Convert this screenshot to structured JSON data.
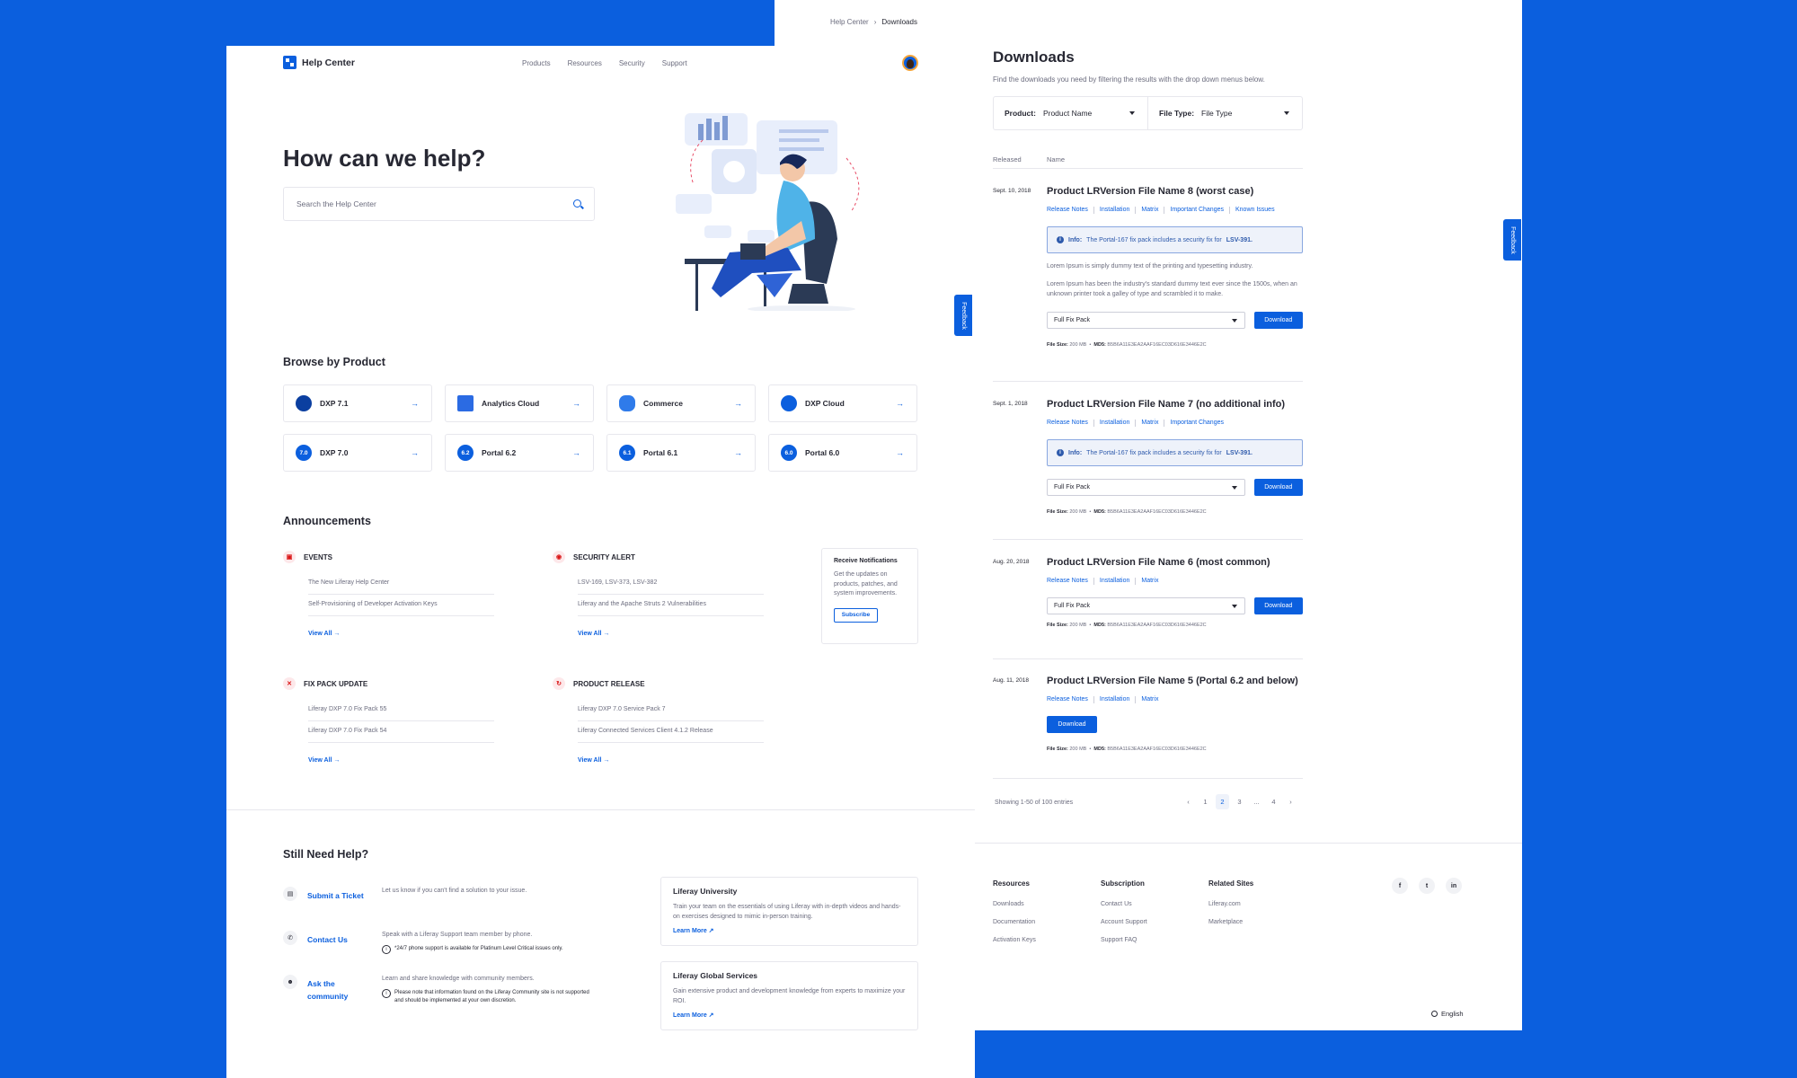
{
  "downloads_page": {
    "breadcrumb": {
      "root": "Help Center",
      "current": "Downloads"
    },
    "title": "Downloads",
    "subtitle": "Find the downloads you need by filtering the results with the drop down menus below.",
    "filters": {
      "product_label": "Product:",
      "product_value": "Product Name",
      "filetype_label": "File Type:",
      "filetype_value": "File Type"
    },
    "columns": {
      "released": "Released",
      "name": "Name"
    },
    "entries": [
      {
        "date": "Sept. 10, 2018",
        "title": "Product LRVersion File Name 8 (worst case)",
        "links": [
          "Release Notes",
          "Installation",
          "Matrix",
          "Important Changes",
          "Known Issues"
        ],
        "info_prefix": "Info:",
        "info_text": "The Portal-167 fix pack includes a security fix for",
        "info_link": "LSV-391.",
        "lorem1": "Lorem Ipsum is simply dummy text of the printing and typesetting industry.",
        "lorem2": "Lorem Ipsum has been the industry's standard dummy text ever since the 1500s, when an unknown printer took a galley of type and scrambled it to make.",
        "select": "Full Fix Pack",
        "button": "Download",
        "file_size_label": "File Size:",
        "file_size": "200 MB",
        "md5_label": "MD5:",
        "md5": "B5B6A11E3EA2AAF16EC03D616E3446E2C"
      },
      {
        "date": "Sept. 1, 2018",
        "title": "Product LRVersion File Name 7 (no additional info)",
        "links": [
          "Release Notes",
          "Installation",
          "Matrix",
          "Important Changes"
        ],
        "info_prefix": "Info:",
        "info_text": "The Portal-167 fix pack includes a security fix for",
        "info_link": "LSV-391.",
        "select": "Full Fix Pack",
        "button": "Download",
        "file_size_label": "File Size:",
        "file_size": "200 MB",
        "md5_label": "MD5:",
        "md5": "B5B6A11E3EA2AAF16EC03D616E3446E2C"
      },
      {
        "date": "Aug. 20, 2018",
        "title": "Product LRVersion File Name 6 (most common)",
        "links": [
          "Release Notes",
          "Installation",
          "Matrix"
        ],
        "select": "Full Fix Pack",
        "button": "Download",
        "file_size_label": "File Size:",
        "file_size": "200 MB",
        "md5_label": "MD5:",
        "md5": "B5B6A11E3EA2AAF16EC03D616E3446E2C"
      },
      {
        "date": "Aug. 11, 2018",
        "title": "Product LRVersion File Name 5 (Portal 6.2 and below)",
        "links": [
          "Release Notes",
          "Installation",
          "Matrix"
        ],
        "button": "Download",
        "file_size_label": "File Size:",
        "file_size": "200 MB",
        "md5_label": "MD5:",
        "md5": "B5B6A11E3EA2AAF16EC03D616E3446E2C"
      }
    ],
    "pagination": {
      "info": "Showing 1-50 of 100 entries",
      "prev": "‹",
      "pages": [
        "1",
        "2",
        "3",
        "...",
        "4"
      ],
      "next": "›",
      "active": "2"
    },
    "footer": {
      "columns": [
        {
          "title": "Resources",
          "links": [
            "Downloads",
            "Documentation",
            "Activation Keys"
          ]
        },
        {
          "title": "Subscription",
          "links": [
            "Contact Us",
            "Account Support",
            "Support FAQ"
          ]
        },
        {
          "title": "Related Sites",
          "links": [
            "Liferay.com",
            "Marketplace"
          ]
        }
      ],
      "socials": [
        {
          "icon": "facebook-icon",
          "glyph": "f"
        },
        {
          "icon": "twitter-icon",
          "glyph": "t"
        },
        {
          "icon": "linkedin-icon",
          "glyph": "in"
        }
      ],
      "language": "English"
    },
    "feedback": "Feedback"
  },
  "help_page": {
    "logo_text": "Help Center",
    "nav": [
      "Products",
      "Resources",
      "Security",
      "Support"
    ],
    "hero_title": "How can we help?",
    "search_placeholder": "Search the Help Center",
    "browse_title": "Browse by Product",
    "products": [
      {
        "name": "DXP 7.1",
        "badge": "",
        "icon": "dxp-logo-icon"
      },
      {
        "name": "Analytics Cloud",
        "badge": "",
        "icon": "analytics-cloud-icon"
      },
      {
        "name": "Commerce",
        "badge": "",
        "icon": "commerce-icon"
      },
      {
        "name": "DXP Cloud",
        "badge": "",
        "icon": "dxp-cloud-icon"
      },
      {
        "name": "DXP 7.0",
        "badge": "7.0",
        "icon": "version-badge-icon"
      },
      {
        "name": "Portal 6.2",
        "badge": "6.2",
        "icon": "version-badge-icon"
      },
      {
        "name": "Portal 6.1",
        "badge": "6.1",
        "icon": "version-badge-icon"
      },
      {
        "name": "Portal 6.0",
        "badge": "6.0",
        "icon": "version-badge-icon"
      }
    ],
    "product_arrow": "→",
    "announcements_title": "Announcements",
    "announcements": [
      {
        "title": "EVENTS",
        "icon": "calendar-icon",
        "glyph": "▣",
        "items": [
          "The New Liferay Help Center",
          "Self-Provisioning of Developer Activation Keys"
        ],
        "view_all": "View All →"
      },
      {
        "title": "SECURITY ALERT",
        "icon": "shield-icon",
        "glyph": "◉",
        "items": [
          "LSV-169, LSV-373, LSV-382",
          "Liferay and the Apache Struts 2 Vulnerabilities"
        ],
        "view_all": "View All →"
      },
      {
        "title": "FIX PACK UPDATE",
        "icon": "tools-icon",
        "glyph": "✕",
        "items": [
          "Liferay DXP 7.0 Fix Pack 55",
          "Liferay DXP 7.0 Fix Pack 54"
        ],
        "view_all": "View All →"
      },
      {
        "title": "PRODUCT RELEASE",
        "icon": "refresh-icon",
        "glyph": "↻",
        "items": [
          "Liferay DXP 7.0 Service Pack 7",
          "Liferay Connected Services Client 4.1.2 Release"
        ],
        "view_all": "View All →"
      }
    ],
    "notify": {
      "title": "Receive Notifications",
      "text": "Get the updates on products, patches, and system improvements.",
      "button": "Subscribe"
    },
    "still_title": "Still Need Help?",
    "help_rows": [
      {
        "link": "Submit a Ticket",
        "icon": "ticket-icon",
        "glyph": "▤",
        "desc": "Let us know if you can't find a solution to your issue.",
        "note": ""
      },
      {
        "link": "Contact Us",
        "icon": "phone-icon",
        "glyph": "✆",
        "desc": "Speak with a Liferay Support team member by phone.",
        "note": "*24/7 phone support is available for Platinum Level Critical issues only."
      },
      {
        "link": "Ask the community",
        "icon": "community-icon",
        "glyph": "☻",
        "desc": "Learn and share knowledge with community members.",
        "note": "Please note that information found on the Liferay Community site is not supported and should be implemented at your own discretion."
      }
    ],
    "cards": [
      {
        "title": "Liferay University",
        "text": "Train your team on the essentials of using Liferay with in-depth videos and hands-on exercises designed to mimic in-person training.",
        "link": "Learn More ↗"
      },
      {
        "title": "Liferay Global Services",
        "text": "Gain extensive product and development knowledge from experts to maximize your ROI.",
        "link": "Learn More ↗"
      }
    ],
    "feedback": "Feedback"
  }
}
